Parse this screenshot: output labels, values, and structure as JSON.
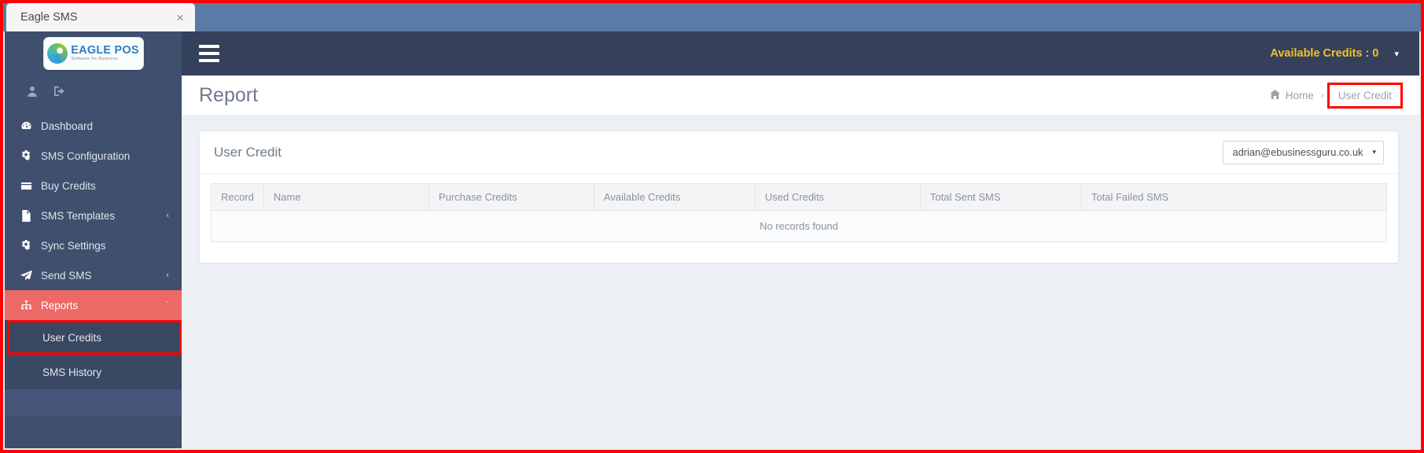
{
  "browser": {
    "tab_title": "Eagle SMS",
    "close_label": "×"
  },
  "brand": {
    "name": "EAGLE POS",
    "tagline": "Software for Business"
  },
  "sidebar": {
    "items": [
      {
        "label": "Dashboard",
        "icon": "dashboard-icon",
        "active": false,
        "caret": ""
      },
      {
        "label": "SMS Configuration",
        "icon": "gears-icon",
        "active": false,
        "caret": ""
      },
      {
        "label": "Buy Credits",
        "icon": "credit-card-icon",
        "active": false,
        "caret": ""
      },
      {
        "label": "SMS Templates",
        "icon": "file-icon",
        "active": false,
        "caret": "‹"
      },
      {
        "label": "Sync Settings",
        "icon": "gears-icon",
        "active": false,
        "caret": ""
      },
      {
        "label": "Send SMS",
        "icon": "paper-plane-icon",
        "active": false,
        "caret": "‹"
      },
      {
        "label": "Reports",
        "icon": "sitemap-icon",
        "active": true,
        "caret": "ˇ"
      }
    ],
    "subitems": [
      {
        "label": "User Credits",
        "highlighted": true
      },
      {
        "label": "SMS History",
        "highlighted": false
      }
    ]
  },
  "topbar": {
    "credits_label": "Available Credits : 0",
    "credits_caret": "▾"
  },
  "page": {
    "title": "Report",
    "breadcrumb": {
      "home": "Home",
      "separator": "›",
      "current": "User Credit"
    }
  },
  "panel": {
    "title": "User Credit",
    "user_select": {
      "value": "adrian@ebusinessguru.co.uk",
      "arrow": "▾"
    }
  },
  "table": {
    "columns": [
      "Record",
      "Name",
      "Purchase Credits",
      "Available Credits",
      "Used Credits",
      "Total Sent SMS",
      "Total Failed SMS"
    ],
    "rows": [],
    "empty_message": "No records found"
  },
  "colors": {
    "sidebar_bg": "#3f4f6d",
    "topbar_bg": "#35405a",
    "active_nav": "#ec6a65",
    "credits_text": "#f2c029",
    "annotation": "#ff0000",
    "browser_bar": "#5b7ba6"
  }
}
